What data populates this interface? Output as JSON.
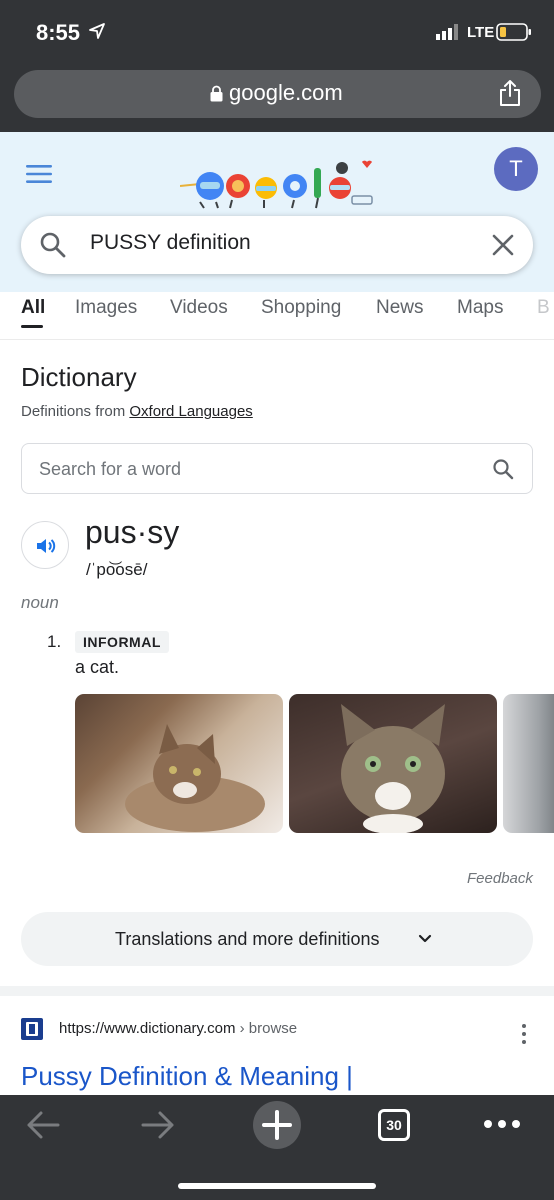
{
  "status_bar": {
    "time": "8:55",
    "network": "LTE"
  },
  "browser": {
    "url": "google.com"
  },
  "search": {
    "query": "PUSSY definition",
    "avatar_initial": "T"
  },
  "tabs": [
    "All",
    "Images",
    "Videos",
    "Shopping",
    "News",
    "Maps",
    "B"
  ],
  "dictionary": {
    "title": "Dictionary",
    "source_prefix": "Definitions from ",
    "source_link": "Oxford Languages",
    "search_placeholder": "Search for a word",
    "headword": "pus·sy",
    "pronunciation": "/ˈpo͝osē/",
    "part_of_speech": "noun",
    "sense_number": "1.",
    "register_label": "INFORMAL",
    "definition": "a cat.",
    "feedback": "Feedback",
    "more_button": "Translations and more definitions"
  },
  "result": {
    "url": "https://www.dictionary.com",
    "breadcrumb": " › browse",
    "title": "Pussy Definition & Meaning |"
  },
  "toolbar": {
    "tab_count": "30"
  },
  "colors": {
    "chrome": "#323437",
    "header_bg": "#e6f3fb",
    "link_blue": "#1a56c9",
    "avatar": "#5c6bc0"
  }
}
